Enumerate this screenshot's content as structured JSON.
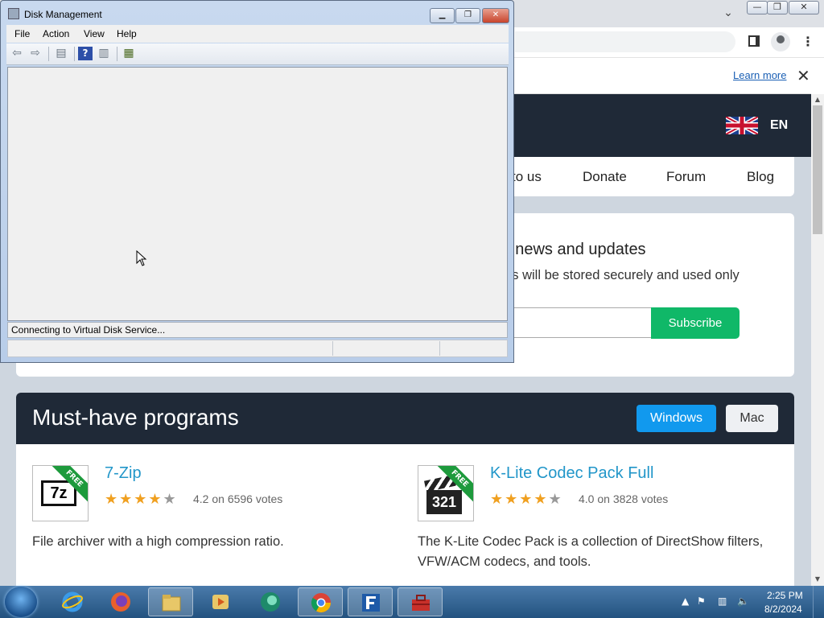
{
  "browser": {
    "infobar": {
      "learn_more": "Learn more",
      "close": "✕"
    },
    "header": {
      "language": "EN"
    },
    "nav": {
      "items": [
        "to us",
        "Donate",
        "Forum",
        "Blog"
      ]
    },
    "newsletter": {
      "title": "r news and updates",
      "text": "ss will be stored securely and used only",
      "subscribe": "Subscribe"
    },
    "programs": {
      "title": "Must-have programs",
      "tab_windows": "Windows",
      "tab_mac": "Mac",
      "items": [
        {
          "name": "7-Zip",
          "badge": "FREE",
          "rating": 4.2,
          "votes": "4.2 on 6596 votes",
          "description": "File archiver with a high compression ratio.",
          "icon_text": "7z"
        },
        {
          "name": "K-Lite Codec Pack Full",
          "badge": "FREE",
          "rating": 4.0,
          "votes": "4.0 on 3828 votes",
          "description": "The K-Lite Codec Pack is a collection of DirectShow filters, VFW/ACM codecs, and tools.",
          "icon_text": "321"
        }
      ]
    },
    "colors": {
      "header": "#1f2937",
      "subscribe": "#10b868",
      "windows_tab": "#1199ee",
      "link": "#2196c9"
    }
  },
  "disk_management": {
    "title": "Disk Management",
    "menu": [
      "File",
      "Action",
      "View",
      "Help"
    ],
    "toolbar_icons": [
      "back-icon",
      "forward-icon",
      "show-hide-console-tree-icon",
      "help-icon",
      "show-hide-action-pane-icon",
      "properties-icon"
    ],
    "status": "Connecting to Virtual Disk Service..."
  },
  "taskbar": {
    "apps": [
      "internet-explorer-icon",
      "firefox-icon",
      "file-explorer-icon",
      "media-player-icon",
      "app-icon",
      "chrome-icon",
      "filezilla-icon",
      "toolbox-icon"
    ],
    "time": "2:25 PM",
    "date": "8/2/2024"
  }
}
